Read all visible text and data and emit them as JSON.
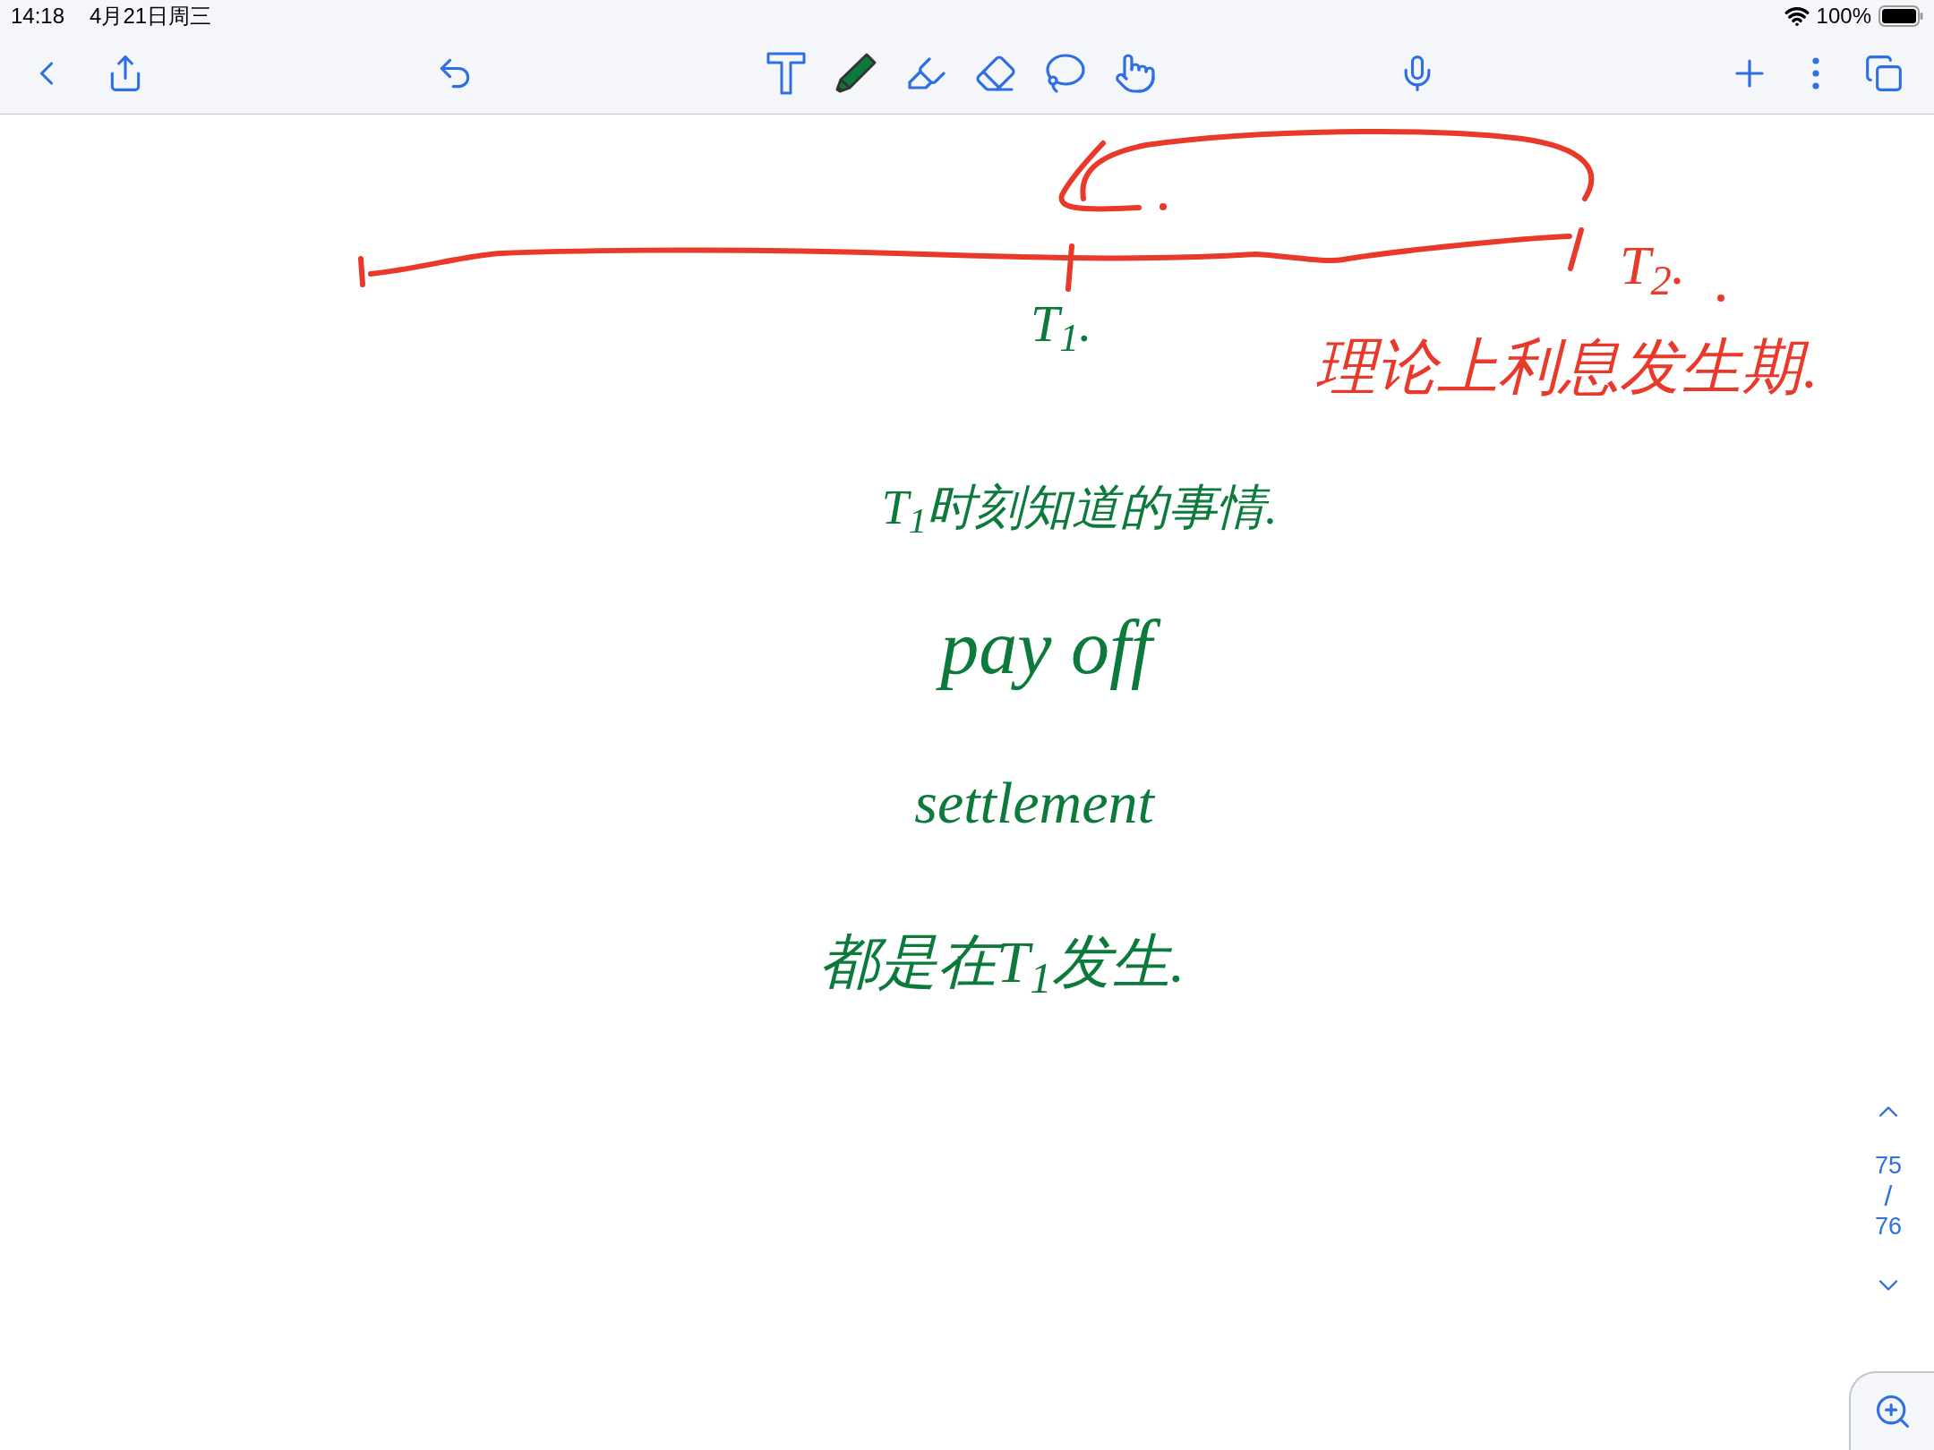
{
  "status_bar": {
    "time": "14:18",
    "date": "4月21日周三",
    "battery": "100%"
  },
  "toolbar": {
    "tools": [
      {
        "kind": "text",
        "selected": false
      },
      {
        "kind": "pen",
        "selected": true,
        "color": "#0b7a3b"
      },
      {
        "kind": "highlighter",
        "selected": false
      },
      {
        "kind": "eraser",
        "selected": false
      },
      {
        "kind": "lasso",
        "selected": false
      },
      {
        "kind": "hand",
        "selected": false
      }
    ]
  },
  "canvas": {
    "notes": [
      {
        "text": "T$_{2}$.",
        "color": "#e8392a"
      },
      {
        "text": "T$_{1}$.",
        "color": "#0b7a3b"
      },
      {
        "text": "理论上利息发生期.",
        "color": "#e8392a"
      },
      {
        "text": "T$_{1}$时刻知道的事情.",
        "color": "#0b7a3b"
      },
      {
        "text": "pay off",
        "color": "#0b7a3b"
      },
      {
        "text": "settlement",
        "color": "#0b7a3b"
      },
      {
        "text": "都是在T$_{1}$发生.",
        "color": "#0b7a3b"
      }
    ]
  },
  "page_indicator": {
    "current": "75",
    "separator": "/",
    "total": "76"
  }
}
